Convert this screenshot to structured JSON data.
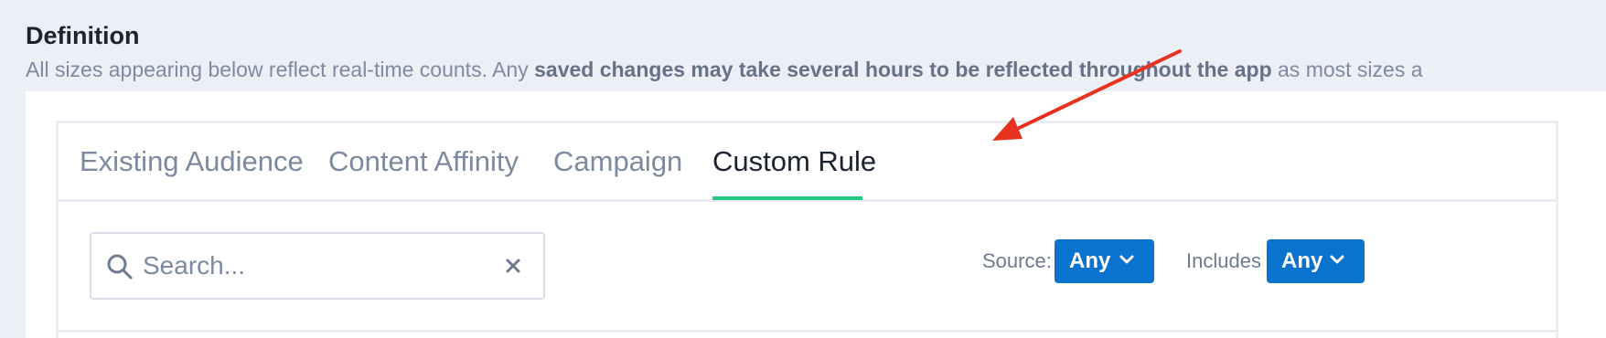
{
  "definition": {
    "title": "Definition",
    "description_prefix": "All sizes appearing below reflect real-time counts. Any ",
    "description_bold": "saved changes may take several hours to be reflected throughout the app",
    "description_suffix": " as most sizes a"
  },
  "tabs": [
    {
      "label": "Existing Audience",
      "active": false
    },
    {
      "label": "Content Affinity",
      "active": false
    },
    {
      "label": "Campaign",
      "active": false
    },
    {
      "label": "Custom Rule",
      "active": true
    }
  ],
  "search": {
    "placeholder": "Search...",
    "value": ""
  },
  "filters": {
    "source_label": "Source:",
    "source_value": "Any",
    "includes_label": "Includes",
    "includes_value": "Any"
  },
  "icons": {
    "search": "search-icon",
    "clear": "close-icon",
    "dropdown": "chevron-down-icon"
  },
  "colors": {
    "accent_blue": "#0a72cf",
    "active_tab_underline": "#24c77e",
    "annotation_arrow": "#e8321f",
    "page_background": "#eceff5"
  }
}
